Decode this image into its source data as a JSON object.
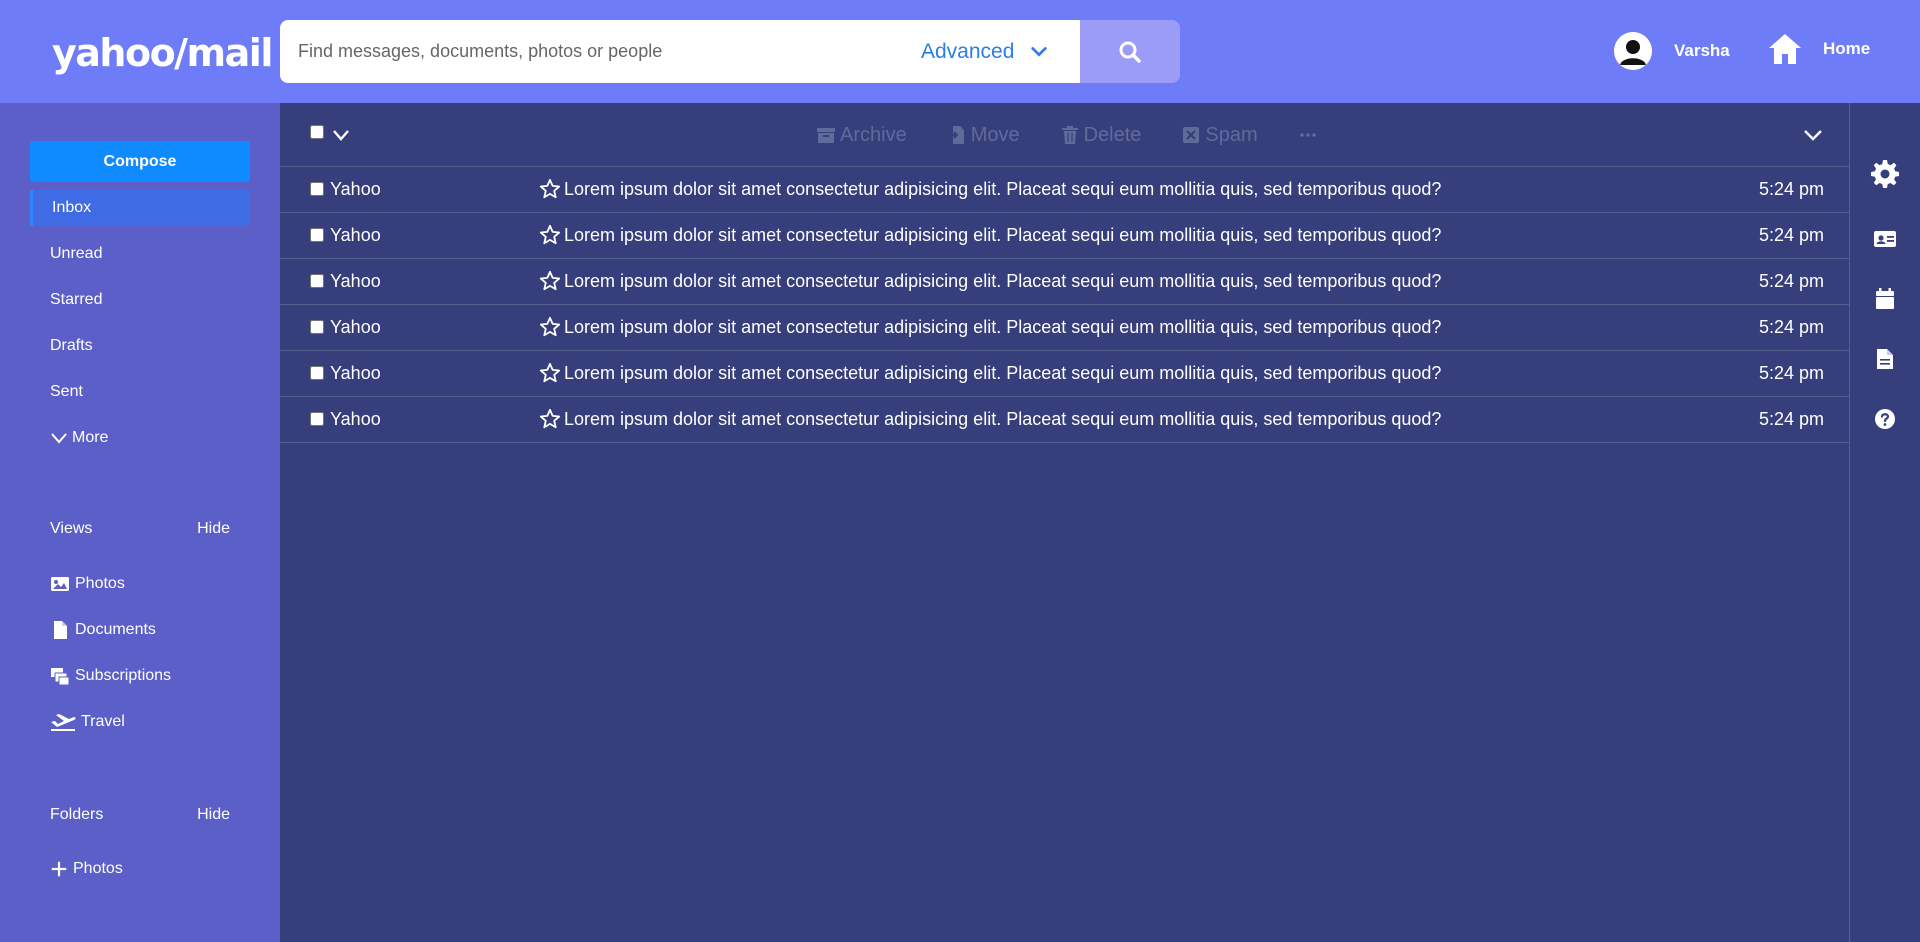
{
  "header": {
    "logo": "yahoo/mail",
    "search_placeholder": "Find messages, documents, photos or people",
    "advanced_label": "Advanced",
    "user_name": "Varsha",
    "home_label": "Home"
  },
  "sidebar": {
    "compose_label": "Compose",
    "nav": [
      "Inbox",
      "Unread",
      "Starred",
      "Drafts",
      "Sent"
    ],
    "more_label": "More",
    "views_title": "Views",
    "views_hide": "Hide",
    "views": [
      "Photos",
      "Documents",
      "Subscriptions",
      "Travel"
    ],
    "folders_title": "Folders",
    "folders_hide": "Hide",
    "folders_add": "Photos"
  },
  "toolbar": {
    "archive": "Archive",
    "move": "Move",
    "delete": "Delete",
    "spam": "Spam"
  },
  "messages": [
    {
      "sender": "Yahoo",
      "subject": "Lorem ipsum dolor sit amet consectetur adipisicing elit. Placeat sequi eum mollitia quis, sed temporibus quod?",
      "time": "5:24 pm"
    },
    {
      "sender": "Yahoo",
      "subject": "Lorem ipsum dolor sit amet consectetur adipisicing elit. Placeat sequi eum mollitia quis, sed temporibus quod?",
      "time": "5:24 pm"
    },
    {
      "sender": "Yahoo",
      "subject": "Lorem ipsum dolor sit amet consectetur adipisicing elit. Placeat sequi eum mollitia quis, sed temporibus quod?",
      "time": "5:24 pm"
    },
    {
      "sender": "Yahoo",
      "subject": "Lorem ipsum dolor sit amet consectetur adipisicing elit. Placeat sequi eum mollitia quis, sed temporibus quod?",
      "time": "5:24 pm"
    },
    {
      "sender": "Yahoo",
      "subject": "Lorem ipsum dolor sit amet consectetur adipisicing elit. Placeat sequi eum mollitia quis, sed temporibus quod?",
      "time": "5:24 pm"
    },
    {
      "sender": "Yahoo",
      "subject": "Lorem ipsum dolor sit amet consectetur adipisicing elit. Placeat sequi eum mollitia quis, sed temporibus quod?",
      "time": "5:24 pm"
    }
  ],
  "rail_icons": [
    "gear-icon",
    "contact-card-icon",
    "calendar-icon",
    "document-icon",
    "help-icon"
  ],
  "colors": {
    "header_bg": "#6f7cf7",
    "sidebar_bg": "#5b5fc7",
    "main_bg": "#363e7b",
    "compose_bg": "#0f8bff",
    "inbox_active_bg": "#3f6be4",
    "advanced_text": "#2d7ee6"
  }
}
